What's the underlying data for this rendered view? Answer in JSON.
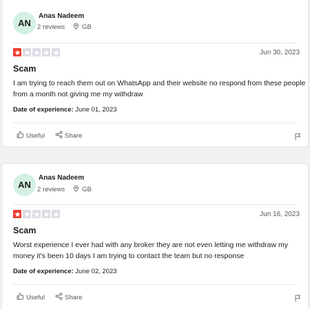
{
  "colors": {
    "star_filled": "#ee3b2e",
    "star_empty": "#dcdce6",
    "avatar_bg": "#d4f0e3"
  },
  "reviews": [
    {
      "avatar_initials": "AN",
      "author": "Anas Nadeem",
      "review_count": "2 reviews",
      "country": "GB",
      "rating": 1,
      "date": "Jun 30, 2023",
      "title": "Scam",
      "text": "I am trying to reach them out on WhatsApp and their website no respond from these people from a month not giving me my withdraw",
      "experience_label": "Date of experience:",
      "experience_date": "June 01, 2023",
      "useful_label": "Useful",
      "share_label": "Share"
    },
    {
      "avatar_initials": "AN",
      "author": "Anas Nadeem",
      "review_count": "2 reviews",
      "country": "GB",
      "rating": 1,
      "date": "Jun 16, 2023",
      "title": "Scam",
      "text": "Worst experience I ever had with any broker they are not even letting me withdraw my money it's been 10 days I am trying to contact the team but no response",
      "experience_label": "Date of experience:",
      "experience_date": "June 02, 2023",
      "useful_label": "Useful",
      "share_label": "Share"
    }
  ]
}
